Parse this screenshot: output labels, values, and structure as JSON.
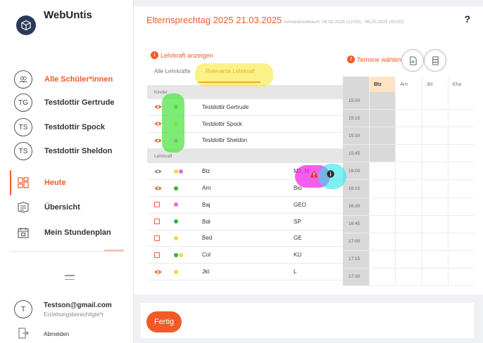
{
  "app": {
    "name": "WebUntis"
  },
  "header": {
    "title": "Elternsprechtag 2025",
    "date": "21.03.2025",
    "period": "Anmeldezeitraum: 04.02.2025 (12:00) - 06.02.2025 (00:00)",
    "help": "?"
  },
  "sidebar": {
    "all_students": "Alle Schüler*innen",
    "students": [
      {
        "initials": "TG",
        "name": "Testdottir Gertrude"
      },
      {
        "initials": "TS",
        "name": "Testdottir Spock"
      },
      {
        "initials": "TS",
        "name": "Testdottir Sheldon"
      }
    ],
    "nav": [
      {
        "label": "Heute",
        "icon": "dashboard-icon"
      },
      {
        "label": "Übersicht",
        "icon": "overview-icon"
      },
      {
        "label": "Mein Stundenplan",
        "icon": "calendar-icon"
      }
    ],
    "user": {
      "initial": "T",
      "email": "Testson@gmail.com",
      "role": "Erziehungsberechtigte*r"
    },
    "logout": "Abmelden"
  },
  "steps": {
    "step1": {
      "num": "1",
      "label": "Lehrkraft anzeigen"
    },
    "step2": {
      "num": "2",
      "label": "Termine wählen"
    }
  },
  "tabs": {
    "all": "Alle Lehrkräfte",
    "relevant": "Relevante Lehrkraft"
  },
  "list": {
    "children_header": "Kinder",
    "teachers_header": "Lehrkraft",
    "children": [
      {
        "name": "Testdottir Gertrude",
        "dot": "#2db34a"
      },
      {
        "name": "Testdottir Spock",
        "dot": "#f5d742"
      },
      {
        "name": "Testdottir Sheldon",
        "dot": "#e86ad6"
      }
    ],
    "teachers": [
      {
        "name": "Btz",
        "subject": "M2, M",
        "state": "eye-gray",
        "dots": [
          "#f5d742",
          "#e86ad6"
        ]
      },
      {
        "name": "Arn",
        "subject": "Bio",
        "state": "eye",
        "dots": [
          "#2db34a"
        ]
      },
      {
        "name": "Baj",
        "subject": "GEO",
        "state": "box",
        "dots": [
          "#e86ad6"
        ]
      },
      {
        "name": "Bdr",
        "subject": "SP",
        "state": "box",
        "dots": [
          "#2db34a"
        ]
      },
      {
        "name": "Bed",
        "subject": "GE",
        "state": "box",
        "dots": [
          "#f5d742"
        ]
      },
      {
        "name": "Col",
        "subject": "KU",
        "state": "box",
        "dots": [
          "#2db34a",
          "#f5d742"
        ]
      },
      {
        "name": "Jkt",
        "subject": "L",
        "state": "eye",
        "dots": [
          "#f5d742"
        ]
      }
    ]
  },
  "grid": {
    "columns": [
      "Btz",
      "Arn",
      "Jkt",
      "Kha"
    ],
    "times": [
      "15:00",
      "15:15",
      "15:30",
      "15:45",
      "16:00",
      "16:15",
      "16:30",
      "16:45",
      "17:00",
      "17:15",
      "17:30"
    ],
    "busy_rows_first_col": 4
  },
  "footer": {
    "done": "Fertig"
  },
  "colors": {
    "accent": "#f05a28",
    "yellow": "#f5d742",
    "green": "#2db34a",
    "pink": "#e86ad6"
  }
}
